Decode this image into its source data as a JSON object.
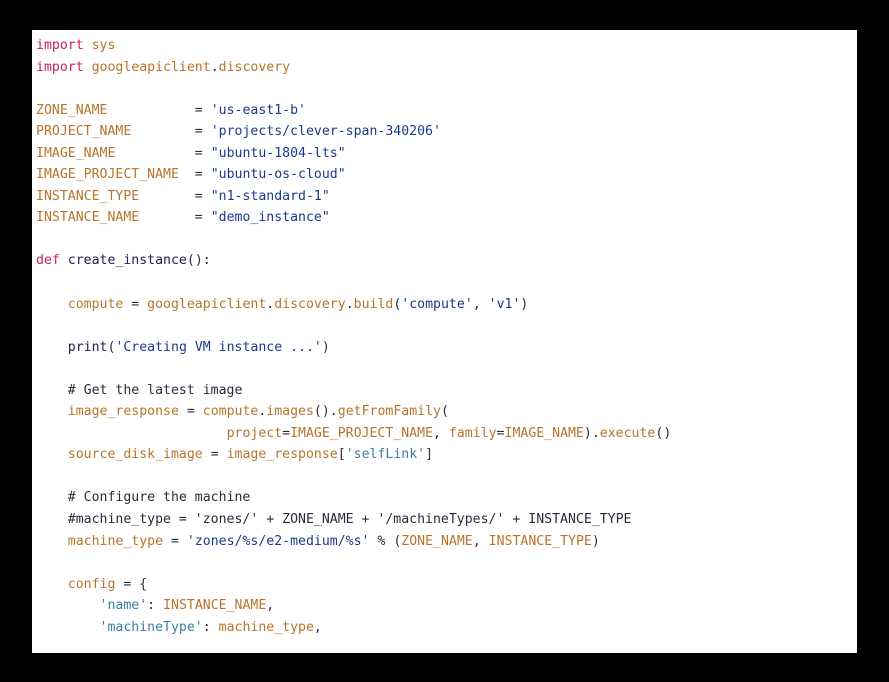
{
  "window": {
    "background_color": "#000000",
    "panel_background_color": "#ffffff",
    "language": "python"
  },
  "theme": {
    "keyword_color": "#cc2255",
    "name_color": "#b8742a",
    "string_color": "#1a3a8f",
    "dict_key_color": "#3f7f9f",
    "function_color": "#20205a",
    "comment_color": "#2b2b3a",
    "operator_color": "#2b2b3a"
  },
  "code": {
    "lines": [
      {
        "id": "line-1",
        "text": "import sys"
      },
      {
        "id": "line-2",
        "text": "import googleapiclient.discovery"
      },
      {
        "id": "line-3",
        "text": ""
      },
      {
        "id": "line-4",
        "text": "ZONE_NAME           = 'us-east1-b'"
      },
      {
        "id": "line-5",
        "text": "PROJECT_NAME        = 'projects/clever-span-340206'"
      },
      {
        "id": "line-6",
        "text": "IMAGE_NAME          = \"ubuntu-1804-lts\""
      },
      {
        "id": "line-7",
        "text": "IMAGE_PROJECT_NAME  = \"ubuntu-os-cloud\""
      },
      {
        "id": "line-8",
        "text": "INSTANCE_TYPE       = \"n1-standard-1\""
      },
      {
        "id": "line-9",
        "text": "INSTANCE_NAME       = \"demo_instance\""
      },
      {
        "id": "line-10",
        "text": ""
      },
      {
        "id": "line-11",
        "text": "def create_instance():"
      },
      {
        "id": "line-12",
        "text": ""
      },
      {
        "id": "line-13",
        "text": "    compute = googleapiclient.discovery.build('compute', 'v1')"
      },
      {
        "id": "line-14",
        "text": ""
      },
      {
        "id": "line-15",
        "text": "    print('Creating VM instance ...')"
      },
      {
        "id": "line-16",
        "text": ""
      },
      {
        "id": "line-17",
        "text": "    # Get the latest image"
      },
      {
        "id": "line-18",
        "text": "    image_response = compute.images().getFromFamily("
      },
      {
        "id": "line-19",
        "text": "                        project=IMAGE_PROJECT_NAME, family=IMAGE_NAME).execute()"
      },
      {
        "id": "line-20",
        "text": "    source_disk_image = image_response['selfLink']"
      },
      {
        "id": "line-21",
        "text": ""
      },
      {
        "id": "line-22",
        "text": "    # Configure the machine"
      },
      {
        "id": "line-23",
        "text": "    #machine_type = 'zones/' + ZONE_NAME + '/machineTypes/' + INSTANCE_TYPE"
      },
      {
        "id": "line-24",
        "text": "    machine_type = 'zones/%s/e2-medium/%s' % (ZONE_NAME, INSTANCE_TYPE)"
      },
      {
        "id": "line-25",
        "text": ""
      },
      {
        "id": "line-26",
        "text": "    config = {"
      },
      {
        "id": "line-27",
        "text": "        'name': INSTANCE_NAME,"
      },
      {
        "id": "line-28",
        "text": "        'machineType': machine_type,"
      }
    ],
    "tokens": {
      "keyword_import": "import",
      "keyword_def": "def",
      "module_sys": "sys",
      "module_googleapiclient": "googleapiclient.discovery",
      "const_zone_name": "ZONE_NAME",
      "const_project_name": "PROJECT_NAME",
      "const_image_name": "IMAGE_NAME",
      "const_image_project_name": "IMAGE_PROJECT_NAME",
      "const_instance_type": "INSTANCE_TYPE",
      "const_instance_name": "INSTANCE_NAME",
      "value_zone_name": "'us-east1-b'",
      "value_project_name": "'projects/clever-span-340206'",
      "value_image_name": "\"ubuntu-1804-lts\"",
      "value_image_project_name": "\"ubuntu-os-cloud\"",
      "value_instance_type": "\"n1-standard-1\"",
      "value_instance_name": "\"demo_instance\"",
      "function_name": "create_instance",
      "var_compute": "compute",
      "var_image_response": "image_response",
      "var_source_disk_image": "source_disk_image",
      "var_machine_type": "machine_type",
      "var_config": "config",
      "builtin_print": "print",
      "string_creating": "'Creating VM instance ...'",
      "string_compute": "'compute'",
      "string_v1": "'v1'",
      "key_self_link": "'selfLink'",
      "key_name": "'name'",
      "key_machine_type": "'machineType'",
      "string_machine_type_fmt": "'zones/%s/e2-medium/%s'",
      "comment_get_latest_image": "# Get the latest image",
      "comment_configure_machine": "# Configure the machine",
      "comment_machine_type": "#machine_type = 'zones/' + ZONE_NAME + '/machineTypes/' + INSTANCE_TYPE"
    }
  }
}
